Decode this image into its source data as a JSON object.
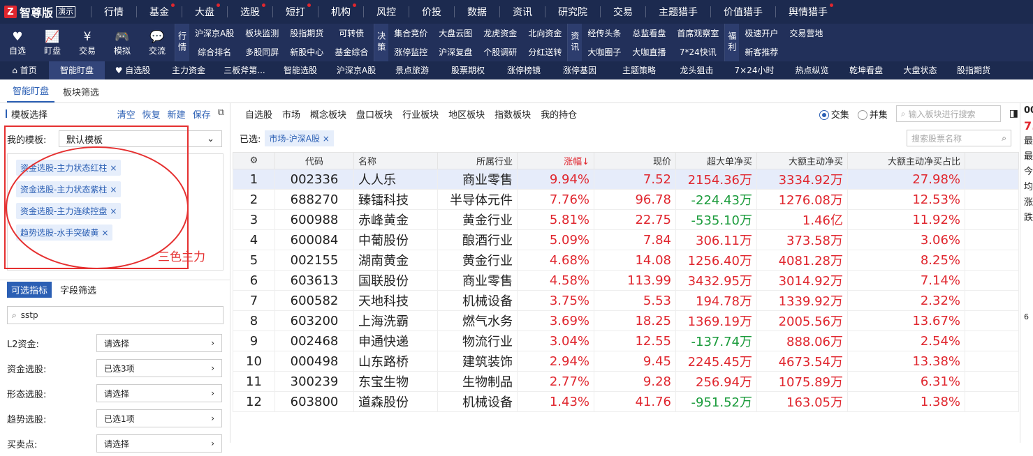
{
  "app": {
    "logo_mark": "Z",
    "name": "智尊版",
    "badge": "演示"
  },
  "topnav": [
    {
      "label": "行情",
      "dot": false
    },
    {
      "label": "基金",
      "dot": true
    },
    {
      "label": "大盘",
      "dot": true
    },
    {
      "label": "选股",
      "dot": true
    },
    {
      "label": "短打",
      "dot": true
    },
    {
      "label": "机构",
      "dot": true
    },
    {
      "label": "风控",
      "dot": false
    },
    {
      "label": "价投",
      "dot": false
    },
    {
      "label": "数据",
      "dot": false
    },
    {
      "label": "资讯",
      "dot": false
    },
    {
      "label": "研究院",
      "dot": false
    },
    {
      "label": "交易",
      "dot": false
    },
    {
      "label": "主题猎手",
      "dot": false
    },
    {
      "label": "价值猎手",
      "dot": false
    },
    {
      "label": "舆情猎手",
      "dot": true
    }
  ],
  "toolbar": {
    "buttons": [
      {
        "label": "自选",
        "icon": "heart-icon",
        "glyph": "♥"
      },
      {
        "label": "盯盘",
        "icon": "chart-icon",
        "glyph": "📈"
      },
      {
        "label": "交易",
        "icon": "yen-icon",
        "glyph": "¥"
      },
      {
        "label": "模拟",
        "icon": "gamepad-icon",
        "glyph": "🎮"
      },
      {
        "label": "交流",
        "icon": "chat-icon",
        "glyph": "💬"
      }
    ],
    "groups": [
      {
        "title": "行情",
        "items": [
          "沪深京A股",
          "综合排名",
          "板块监测",
          "多股同屏",
          "股指期货",
          "新股中心",
          "可转债",
          "基金综合"
        ]
      },
      {
        "title": "决策",
        "items": [
          "集合竞价",
          "涨停监控",
          "大盘云图",
          "沪深复盘",
          "龙虎资金",
          "个股调研",
          "北向资金",
          "分红送转"
        ]
      },
      {
        "title": "资讯",
        "items": [
          "经传头条",
          "大咖圈子",
          "总监看盘",
          "大咖直播",
          "首席观察室",
          "7*24快讯"
        ]
      },
      {
        "title": "福利",
        "items": [
          "极速开户",
          "新客推荐",
          "交易营地",
          ""
        ]
      }
    ]
  },
  "navbar": [
    {
      "label": "⌂ 首页",
      "active": false
    },
    {
      "label": "智能盯盘",
      "active": true
    },
    {
      "label": "♥ 自选股",
      "active": false
    },
    {
      "label": "主力资金",
      "active": false
    },
    {
      "label": "三板斧第...",
      "active": false
    },
    {
      "label": "智能选股",
      "active": false
    },
    {
      "label": "沪深京A股",
      "active": false
    },
    {
      "label": "景点旅游",
      "active": false
    },
    {
      "label": "股票期权",
      "active": false
    },
    {
      "label": "涨停榜镜",
      "active": false
    },
    {
      "label": "涨停基因",
      "active": false
    },
    {
      "label": "主题策略",
      "active": false
    },
    {
      "label": "龙头狙击",
      "active": false
    },
    {
      "label": "7×24小时",
      "active": false
    },
    {
      "label": "热点纵览",
      "active": false
    },
    {
      "label": "乾坤看盘",
      "active": false
    },
    {
      "label": "大盘状态",
      "active": false
    },
    {
      "label": "股指期货",
      "active": false
    }
  ],
  "subtabs": [
    {
      "label": "智能盯盘",
      "active": true
    },
    {
      "label": "板块筛选",
      "active": false
    }
  ],
  "left": {
    "header": "模板选择",
    "actions": [
      "清空",
      "恢复",
      "新建",
      "保存"
    ],
    "template_label": "我的模板:",
    "template_value": "默认模板",
    "tags": [
      "资金选股-主力状态红柱",
      "资金选股-主力状态紫柱",
      "资金选股-主力连续控盘",
      "趋势选股-水手突破黄"
    ],
    "annotation": "三色主力",
    "tabs": [
      {
        "label": "可选指标",
        "active": true
      },
      {
        "label": "字段筛选",
        "active": false
      }
    ],
    "search_value": "sstp",
    "filters": [
      {
        "label": "L2资金:",
        "value": "请选择"
      },
      {
        "label": "资金选股:",
        "value": "已选3项"
      },
      {
        "label": "形态选股:",
        "value": "请选择"
      },
      {
        "label": "趋势选股:",
        "value": "已选1项"
      },
      {
        "label": "买卖点:",
        "value": "请选择"
      }
    ]
  },
  "right": {
    "tabs": [
      "自选股",
      "市场",
      "概念板块",
      "盘口板块",
      "行业板块",
      "地区板块",
      "指数板块",
      "我的持仓"
    ],
    "mode_options": [
      {
        "label": "交集",
        "selected": true
      },
      {
        "label": "并集",
        "selected": false
      }
    ],
    "board_search_placeholder": "输入板块进行搜索",
    "chosen_label": "已选:",
    "chosen_chip": "市场-沪深A股",
    "stock_search_placeholder": "搜索股票名称",
    "columns": [
      "代码",
      "名称",
      "所属行业",
      "涨幅↓",
      "现价",
      "超大单净买",
      "大额主动净买",
      "大额主动净买占比"
    ],
    "rows": [
      {
        "idx": "1",
        "code": "002336",
        "name": "人人乐",
        "industry": "商业零售",
        "pct": "9.94%",
        "price": "7.52",
        "xl": "2154.36万",
        "xl_neg": false,
        "large": "3334.92万",
        "ratio": "27.98%"
      },
      {
        "idx": "2",
        "code": "688270",
        "name": "臻镭科技",
        "industry": "半导体元件",
        "pct": "7.76%",
        "price": "96.78",
        "xl": "-224.43万",
        "xl_neg": true,
        "large": "1276.08万",
        "ratio": "12.53%"
      },
      {
        "idx": "3",
        "code": "600988",
        "name": "赤峰黄金",
        "industry": "黄金行业",
        "pct": "5.81%",
        "price": "22.75",
        "xl": "-535.10万",
        "xl_neg": true,
        "large": "1.46亿",
        "ratio": "11.92%"
      },
      {
        "idx": "4",
        "code": "600084",
        "name": "中葡股份",
        "industry": "酿酒行业",
        "pct": "5.09%",
        "price": "7.84",
        "xl": "306.11万",
        "xl_neg": false,
        "large": "373.58万",
        "ratio": "3.06%"
      },
      {
        "idx": "5",
        "code": "002155",
        "name": "湖南黄金",
        "industry": "黄金行业",
        "pct": "4.68%",
        "price": "14.08",
        "xl": "1256.40万",
        "xl_neg": false,
        "large": "4081.28万",
        "ratio": "8.25%"
      },
      {
        "idx": "6",
        "code": "603613",
        "name": "国联股份",
        "industry": "商业零售",
        "pct": "4.58%",
        "price": "113.99",
        "xl": "3432.95万",
        "xl_neg": false,
        "large": "3014.92万",
        "ratio": "7.14%"
      },
      {
        "idx": "7",
        "code": "600582",
        "name": "天地科技",
        "industry": "机械设备",
        "pct": "3.75%",
        "price": "5.53",
        "xl": "194.78万",
        "xl_neg": false,
        "large": "1339.92万",
        "ratio": "2.32%"
      },
      {
        "idx": "8",
        "code": "603200",
        "name": "上海洗霸",
        "industry": "燃气水务",
        "pct": "3.69%",
        "price": "18.25",
        "xl": "1369.19万",
        "xl_neg": false,
        "large": "2005.56万",
        "ratio": "13.67%"
      },
      {
        "idx": "9",
        "code": "002468",
        "name": "申通快递",
        "industry": "物流行业",
        "pct": "3.04%",
        "price": "12.55",
        "xl": "-137.74万",
        "xl_neg": true,
        "large": "888.06万",
        "ratio": "2.54%"
      },
      {
        "idx": "10",
        "code": "000498",
        "name": "山东路桥",
        "industry": "建筑装饰",
        "pct": "2.94%",
        "price": "9.45",
        "xl": "2245.45万",
        "xl_neg": false,
        "large": "4673.54万",
        "ratio": "13.38%"
      },
      {
        "idx": "11",
        "code": "300239",
        "name": "东宝生物",
        "industry": "生物制品",
        "pct": "2.77%",
        "price": "9.28",
        "xl": "256.94万",
        "xl_neg": false,
        "large": "1075.89万",
        "ratio": "6.31%"
      },
      {
        "idx": "12",
        "code": "603800",
        "name": "道森股份",
        "industry": "机械设备",
        "pct": "1.43%",
        "price": "41.76",
        "xl": "-951.52万",
        "xl_neg": true,
        "large": "163.05万",
        "ratio": "1.38%"
      }
    ]
  },
  "side_panel": [
    "00",
    "7.",
    "最",
    "最",
    "今",
    "均",
    "涨",
    "跌",
    "6"
  ],
  "colors": {
    "up": "#e0262e",
    "down": "#1a9b3b",
    "accent": "#2b5fb4",
    "header_bg": "#1c2a4f"
  }
}
